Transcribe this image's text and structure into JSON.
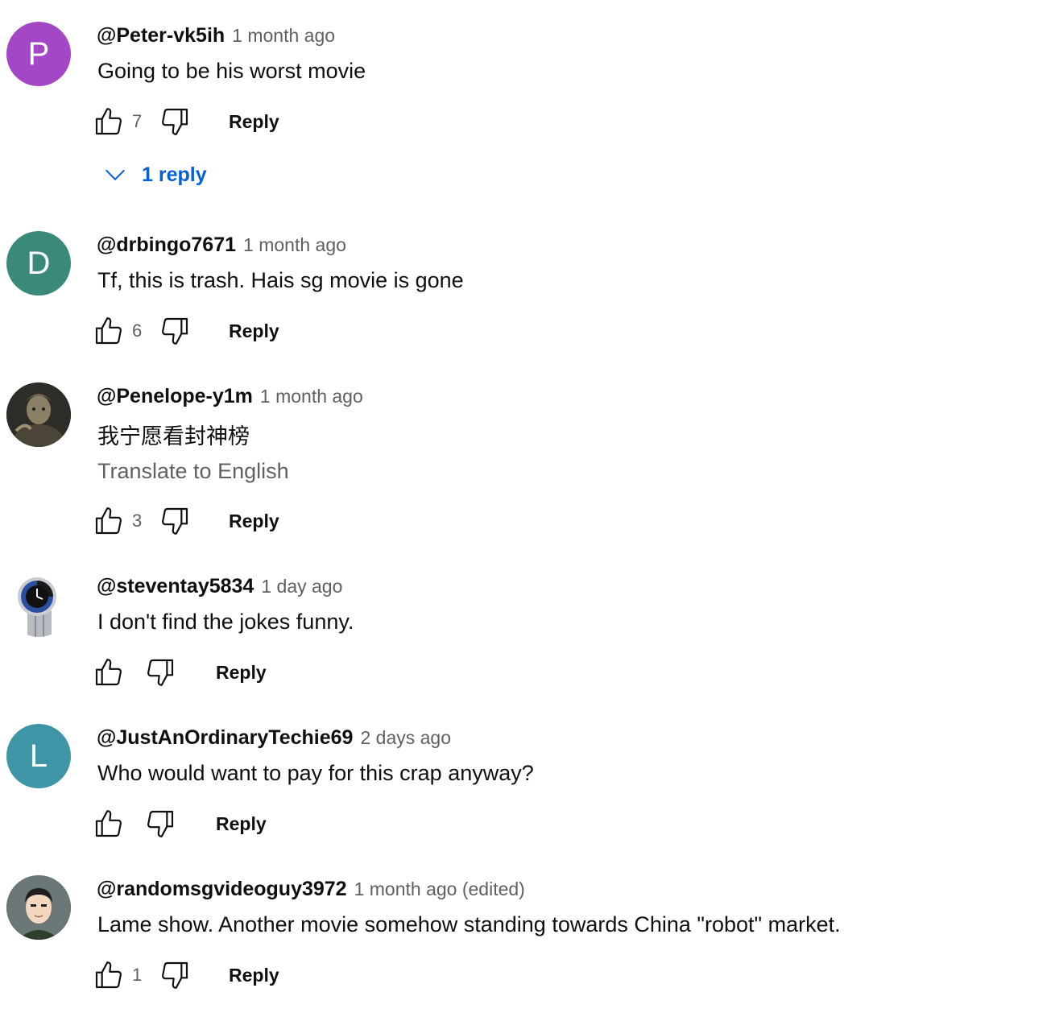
{
  "ui": {
    "reply_label": "Reply",
    "translate_label": "Translate to English"
  },
  "comments": [
    {
      "author": "@Peter-vk5ih",
      "time": "1 month ago",
      "text": "Going to be his worst movie",
      "likes": "7",
      "avatar_letter": "P",
      "avatar_color": "#a347c7",
      "replies_label": "1 reply"
    },
    {
      "author": "@drbingo7671",
      "time": "1 month ago",
      "text": "Tf, this is trash. Hais sg movie is gone",
      "likes": "6",
      "avatar_letter": "D",
      "avatar_color": "#3a8a7a"
    },
    {
      "author": "@Penelope-y1m",
      "time": "1 month ago",
      "text": "我宁愿看封神榜",
      "likes": "3",
      "avatar_icon": "photo-avatar"
    },
    {
      "author": "@steventay5834",
      "time": "1 day ago",
      "text": "I don't find the jokes funny.",
      "likes": "",
      "avatar_icon": "watch-avatar"
    },
    {
      "author": "@JustAnOrdinaryTechie69",
      "time": "2 days ago",
      "text": "Who would want to pay for this crap anyway?",
      "likes": "",
      "avatar_letter": "L",
      "avatar_color": "#3e95a6"
    },
    {
      "author": "@randomsgvideoguy3972",
      "time": "1 month ago (edited)",
      "text": "Lame show. Another movie somehow standing towards China \"robot\" market.",
      "likes": "1",
      "avatar_icon": "cartoon-face-avatar"
    }
  ]
}
